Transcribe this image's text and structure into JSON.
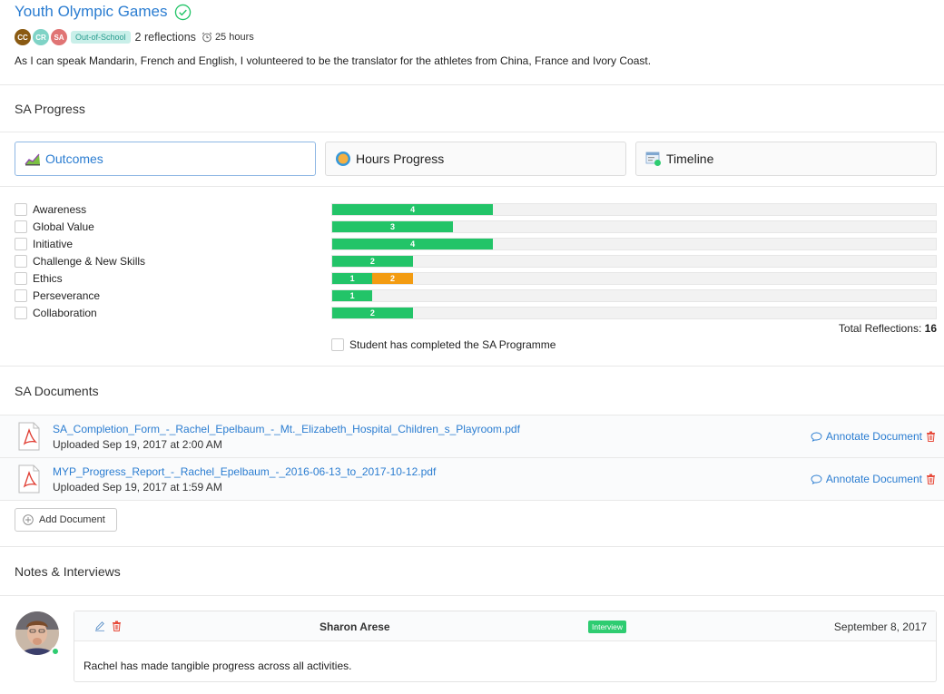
{
  "activity": {
    "title": "Youth Olympic Games",
    "avatars": [
      {
        "initials": "CC",
        "color": "#8a5a12"
      },
      {
        "initials": "CR",
        "color": "#7fd3c6"
      },
      {
        "initials": "SA",
        "color": "#e07474"
      }
    ],
    "category": "Out-of-School",
    "reflections": "2 reflections",
    "hours": "25 hours",
    "description": "As I can speak Mandarin, French and English, I volunteered to be the translator for the athletes from China, France and Ivory Coast."
  },
  "progress": {
    "section_title": "SA Progress",
    "tabs": [
      {
        "label": "Outcomes",
        "icon": "chart-icon"
      },
      {
        "label": "Hours Progress",
        "icon": "globe-icon"
      },
      {
        "label": "Timeline",
        "icon": "timeline-icon"
      }
    ],
    "outcomes": [
      {
        "label": "Awareness",
        "segments": [
          {
            "value": "4",
            "count": 4,
            "color": "#22c468"
          }
        ]
      },
      {
        "label": "Global Value",
        "segments": [
          {
            "value": "3",
            "count": 3,
            "color": "#22c468"
          }
        ]
      },
      {
        "label": "Initiative",
        "segments": [
          {
            "value": "4",
            "count": 4,
            "color": "#22c468"
          }
        ]
      },
      {
        "label": "Challenge & New Skills",
        "segments": [
          {
            "value": "2",
            "count": 2,
            "color": "#22c468"
          }
        ]
      },
      {
        "label": "Ethics",
        "segments": [
          {
            "value": "1",
            "count": 1,
            "color": "#22c468"
          },
          {
            "value": "2",
            "count": 1,
            "color": "#f39c12"
          }
        ]
      },
      {
        "label": "Perseverance",
        "segments": [
          {
            "value": "1",
            "count": 1,
            "color": "#22c468"
          }
        ]
      },
      {
        "label": "Collaboration",
        "segments": [
          {
            "value": "2",
            "count": 2,
            "color": "#22c468"
          }
        ]
      }
    ],
    "scale_max": 15,
    "total_label": "Total Reflections:",
    "total_value": "16",
    "completed_label": "Student has completed the SA Programme"
  },
  "documents": {
    "section_title": "SA Documents",
    "items": [
      {
        "name": "SA_Completion_Form_-_Rachel_Epelbaum_-_Mt._Elizabeth_Hospital_Children_s_Playroom.pdf",
        "uploaded": "Uploaded Sep 19, 2017 at 2:00 AM"
      },
      {
        "name": "MYP_Progress_Report_-_Rachel_Epelbaum_-_2016-06-13_to_2017-10-12.pdf",
        "uploaded": "Uploaded Sep 19, 2017 at 1:59 AM"
      }
    ],
    "annotate_label": "Annotate Document",
    "add_label": "Add Document"
  },
  "notes": {
    "section_title": "Notes & Interviews",
    "items": [
      {
        "author": "Sharon Arese",
        "badge": "Interview",
        "date": "September 8, 2017",
        "text": "Rachel has made tangible progress across all activities."
      }
    ]
  },
  "colors": {
    "accent": "#2b7dd1",
    "green": "#22c468",
    "orange": "#f39c12",
    "danger": "#e74c3c"
  }
}
